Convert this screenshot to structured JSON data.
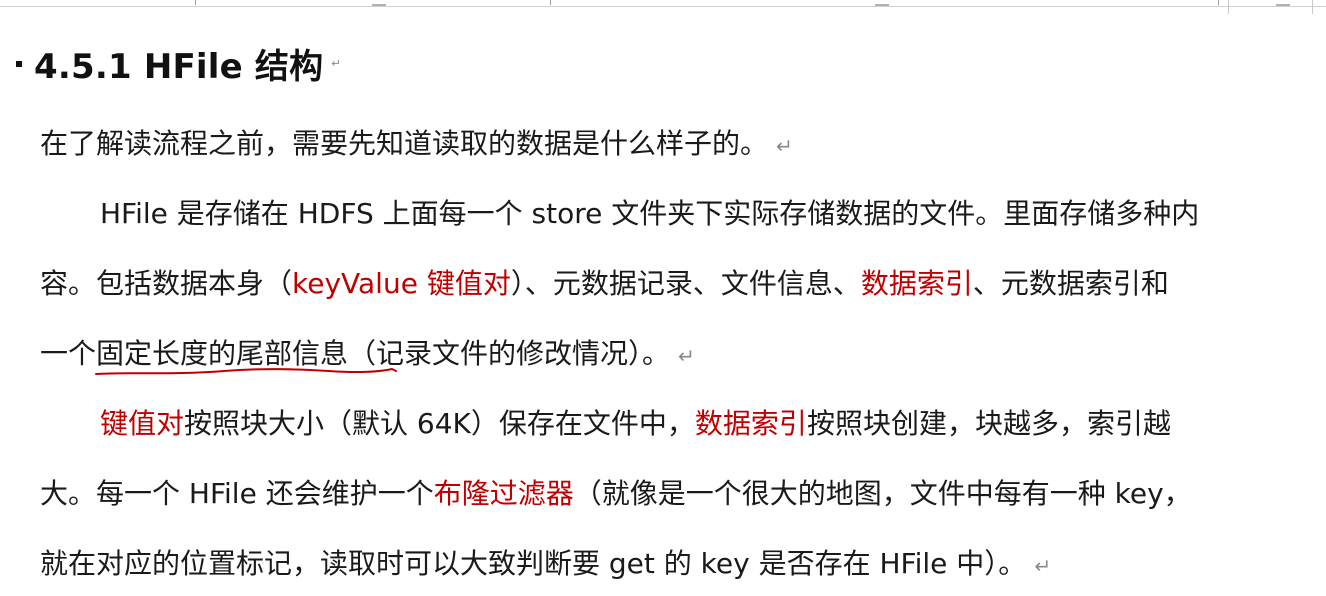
{
  "heading": {
    "text": "4.5.1 HFile 结构"
  },
  "lines": {
    "l1": "在了解读流程之前，需要先知道读取的数据是什么样子的。",
    "l2": "HFile 是存储在 HDFS 上面每一个 store 文件夹下实际存储数据的文件。里面存储多种内",
    "l3a": "容。包括数据本身（",
    "l3b": "keyValue 键值对",
    "l3c": "）、元数据记录、文件信息、",
    "l3d": "数据索引",
    "l3e": "、元数据索引和",
    "l4a": "一个",
    "l4b": "固定长度的尾部信息",
    "l4c": "（记录文件的修改情况）。",
    "l5a": "键值对",
    "l5b": "按照块大小（默认 64K）保存在文件中，",
    "l5c": "数据索引",
    "l5d": "按照块创建，块越多，索引越",
    "l6a": "大。每一个 HFile 还会维护一个",
    "l6b": "布隆过滤器",
    "l6c": "（就像是一个很大的地图，文件中每有一种 key，",
    "l7": "就在对应的位置标记，读取时可以大致判断要 get 的 key 是否存在 HFile 中）。"
  },
  "paragraph_mark": "↵",
  "colors": {
    "highlight_red": "#c00000",
    "text": "#1a1a1a",
    "paragraph_mark": "#8a8a8a",
    "annotation_underline": "#c00000"
  }
}
